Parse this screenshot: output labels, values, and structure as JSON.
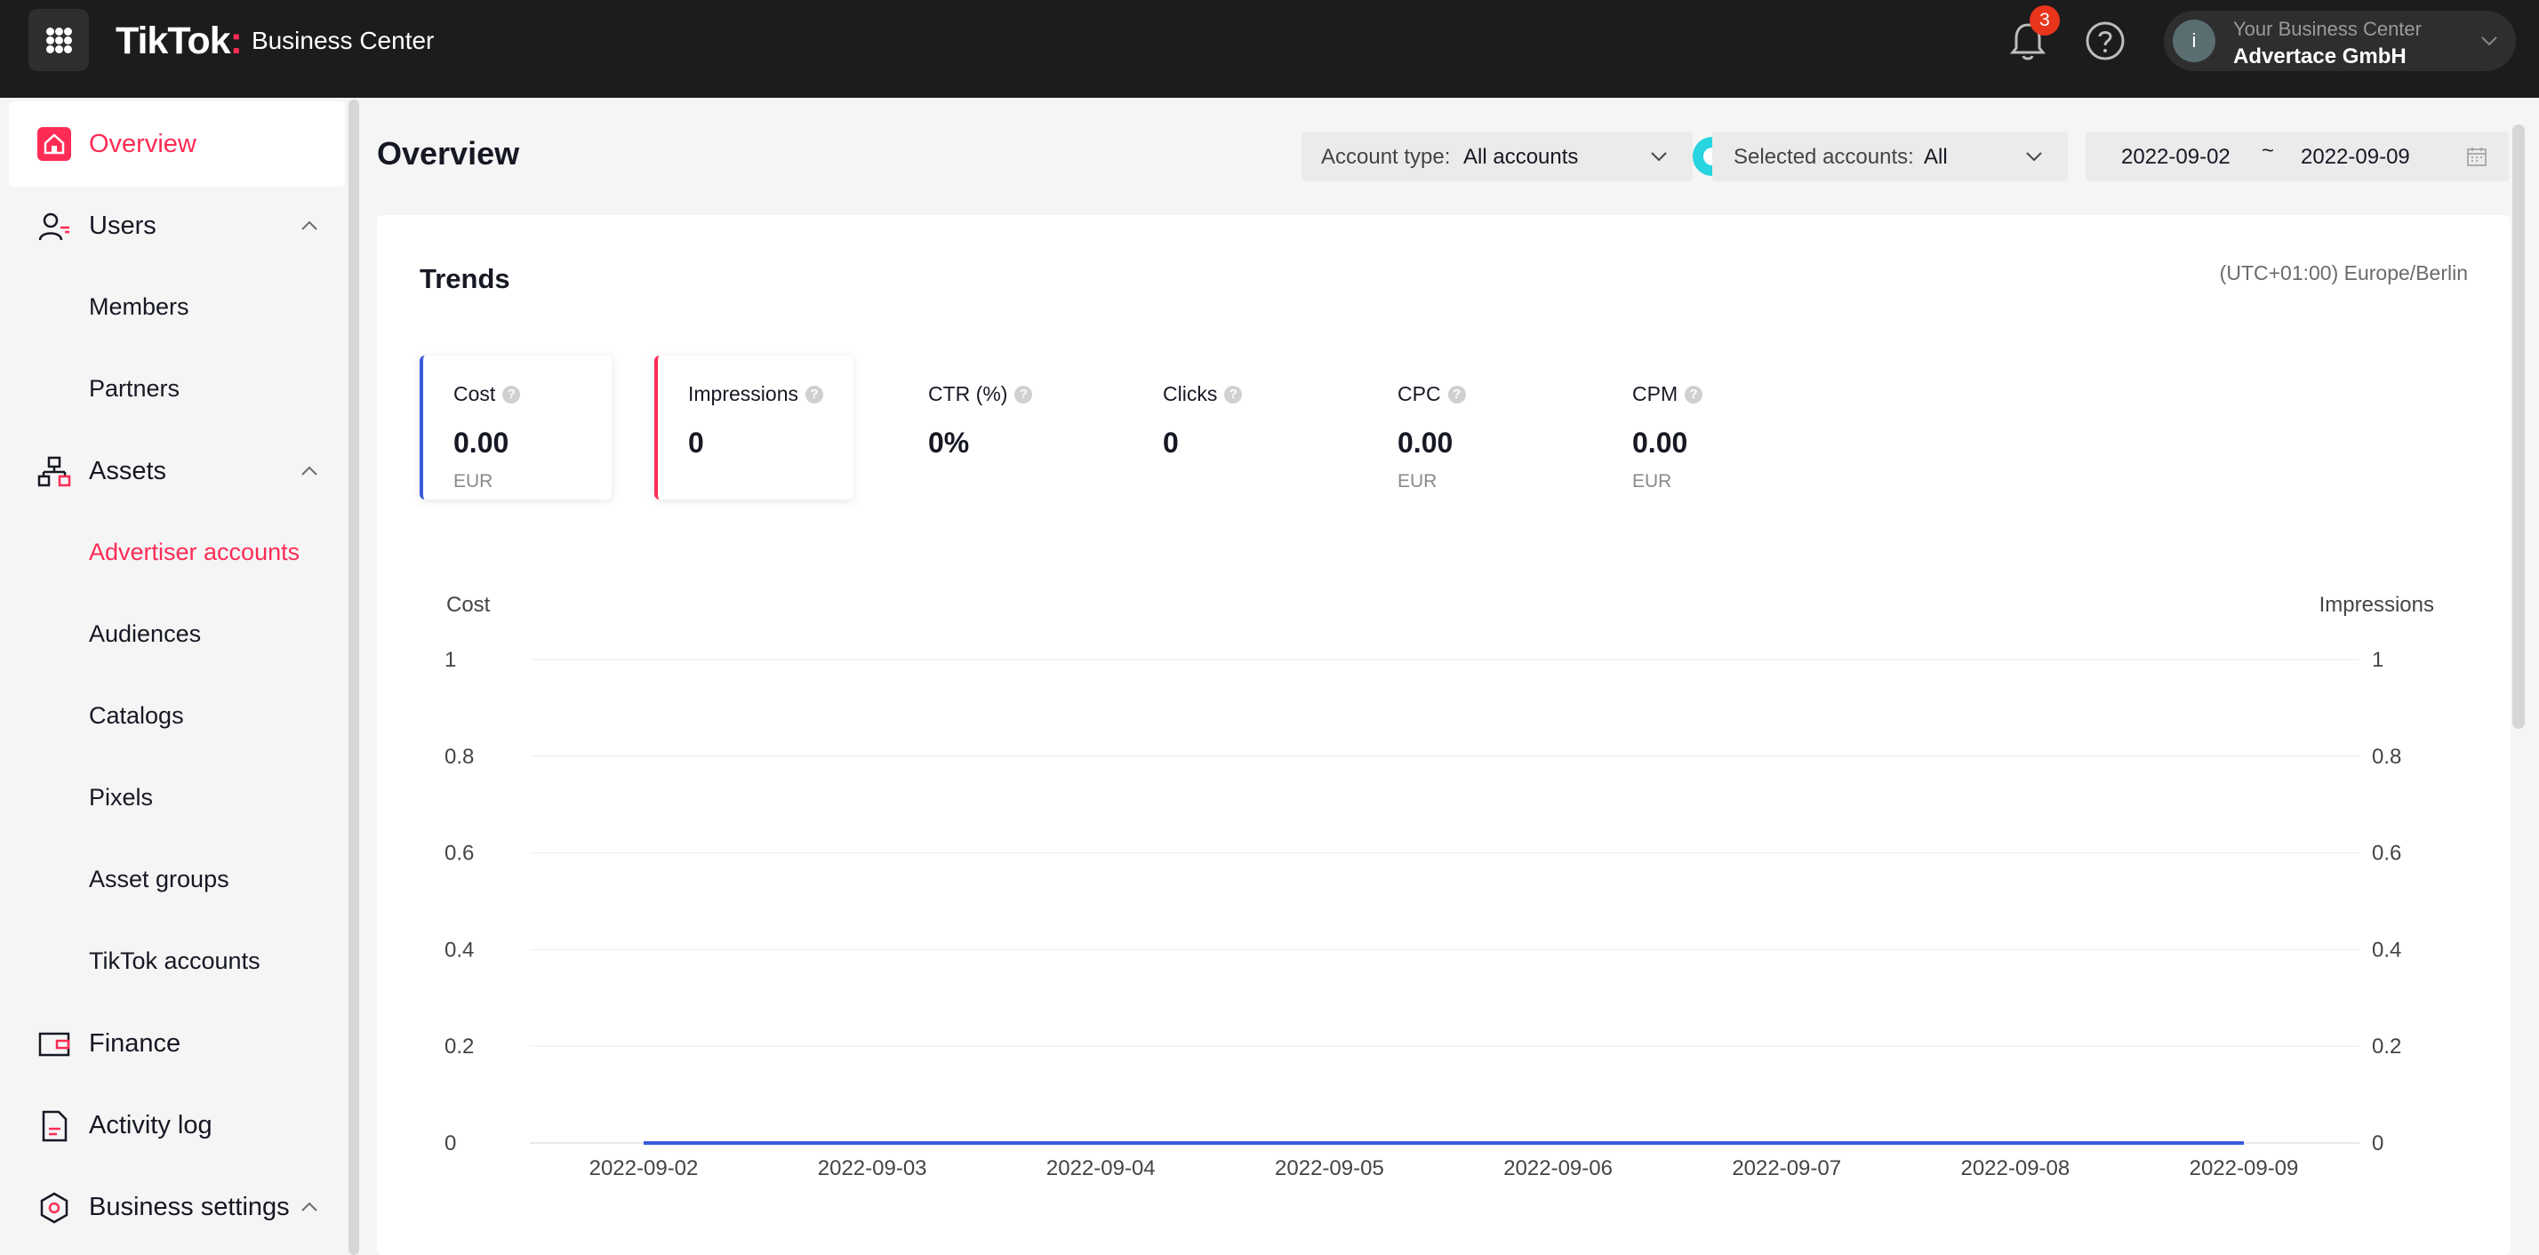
{
  "app": {
    "brand": "TikTok",
    "product": "Business Center",
    "notifications_count": "3",
    "account_label": "Your Business Center",
    "account_name": "Advertace GmbH",
    "avatar_initial": "i"
  },
  "sidebar": {
    "items": [
      {
        "label": "Overview"
      },
      {
        "label": "Users"
      },
      {
        "label": "Members"
      },
      {
        "label": "Partners"
      },
      {
        "label": "Assets"
      },
      {
        "label": "Advertiser accounts"
      },
      {
        "label": "Audiences"
      },
      {
        "label": "Catalogs"
      },
      {
        "label": "Pixels"
      },
      {
        "label": "Asset groups"
      },
      {
        "label": "TikTok accounts"
      },
      {
        "label": "Finance"
      },
      {
        "label": "Activity log"
      },
      {
        "label": "Business settings"
      }
    ]
  },
  "page": {
    "title": "Overview",
    "account_type_label": "Account type:",
    "account_type_value": "All accounts",
    "selected_accounts_label": "Selected accounts:",
    "selected_accounts_value": "All",
    "date_start": "2022-09-02",
    "date_sep": "~",
    "date_end": "2022-09-09"
  },
  "trends": {
    "title": "Trends",
    "timezone": "(UTC+01:00) Europe/Berlin",
    "metrics": [
      {
        "label": "Cost",
        "value": "0.00",
        "unit": "EUR"
      },
      {
        "label": "Impressions",
        "value": "0",
        "unit": ""
      },
      {
        "label": "CTR (%)",
        "value": "0%",
        "unit": ""
      },
      {
        "label": "Clicks",
        "value": "0",
        "unit": ""
      },
      {
        "label": "CPC",
        "value": "0.00",
        "unit": "EUR"
      },
      {
        "label": "CPM",
        "value": "0.00",
        "unit": "EUR"
      }
    ]
  },
  "colors": {
    "accent": "#fe2c55",
    "cost_line": "#3b5bdb",
    "impressions_line": "#fe2c55",
    "topbar": "#1c1c1c"
  },
  "chart_data": {
    "type": "line",
    "ylabel_left": "Cost",
    "ylabel_right": "Impressions",
    "x": [
      "2022-09-02",
      "2022-09-03",
      "2022-09-04",
      "2022-09-05",
      "2022-09-06",
      "2022-09-07",
      "2022-09-08",
      "2022-09-09"
    ],
    "yticks_left": [
      "1",
      "0.8",
      "0.6",
      "0.4",
      "0.2",
      "0"
    ],
    "yticks_right": [
      "1",
      "0.8",
      "0.6",
      "0.4",
      "0.2",
      "0"
    ],
    "ylim": [
      0,
      1
    ],
    "grid": true,
    "series": [
      {
        "name": "Cost",
        "axis": "left",
        "values": [
          0,
          0,
          0,
          0,
          0,
          0,
          0,
          0
        ]
      },
      {
        "name": "Impressions",
        "axis": "right",
        "values": [
          0,
          0,
          0,
          0,
          0,
          0,
          0,
          0
        ]
      }
    ]
  }
}
